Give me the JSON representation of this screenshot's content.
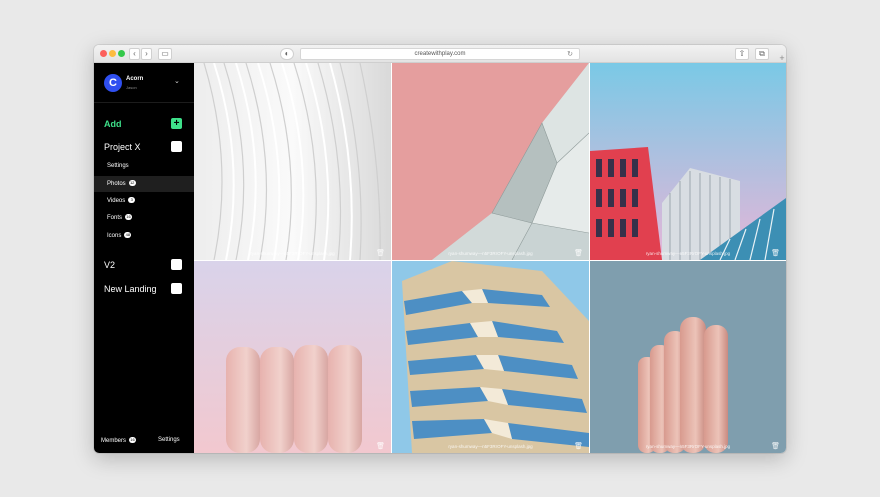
{
  "browser": {
    "url": "createwithplay.com",
    "back_icon": "chevron-left-icon",
    "forward_icon": "chevron-right-icon"
  },
  "sidebar": {
    "workspace": {
      "initial": "C",
      "name": "Acorn",
      "subtitle": "Jason"
    },
    "add_label": "Add",
    "projects": [
      {
        "label": "Project X"
      },
      {
        "label": "V2"
      },
      {
        "label": "New Landing"
      }
    ],
    "project_x_items": [
      {
        "label": "Settings",
        "badge": ""
      },
      {
        "label": "Photos",
        "badge": "12"
      },
      {
        "label": "Videos",
        "badge": "3"
      },
      {
        "label": "Fonts",
        "badge": "16"
      },
      {
        "label": "Icons",
        "badge": "48"
      }
    ],
    "footer": {
      "members_label": "Members",
      "members_badge": "16",
      "settings_label": "Settings"
    }
  },
  "gallery": {
    "files": [
      {
        "name": "ryan-shumway—n5F3RrOFY-unsplash.jpg"
      },
      {
        "name": "ryan-shumway—n5F3RrOFY-unsplash.jpg"
      },
      {
        "name": "ryan-shumway—n5F3RrOFY-unsplash.jpg"
      },
      {
        "name": ""
      },
      {
        "name": "ryan-shumway—n5F3RrOFY-unsplash.jpg"
      },
      {
        "name": "ryan-shumway—n5F3RrOFY-unsplash.jpg"
      }
    ]
  },
  "colors": {
    "accent": "#3ee08a",
    "avatar": "#2f4ff0",
    "sidebar_bg": "#000000"
  }
}
